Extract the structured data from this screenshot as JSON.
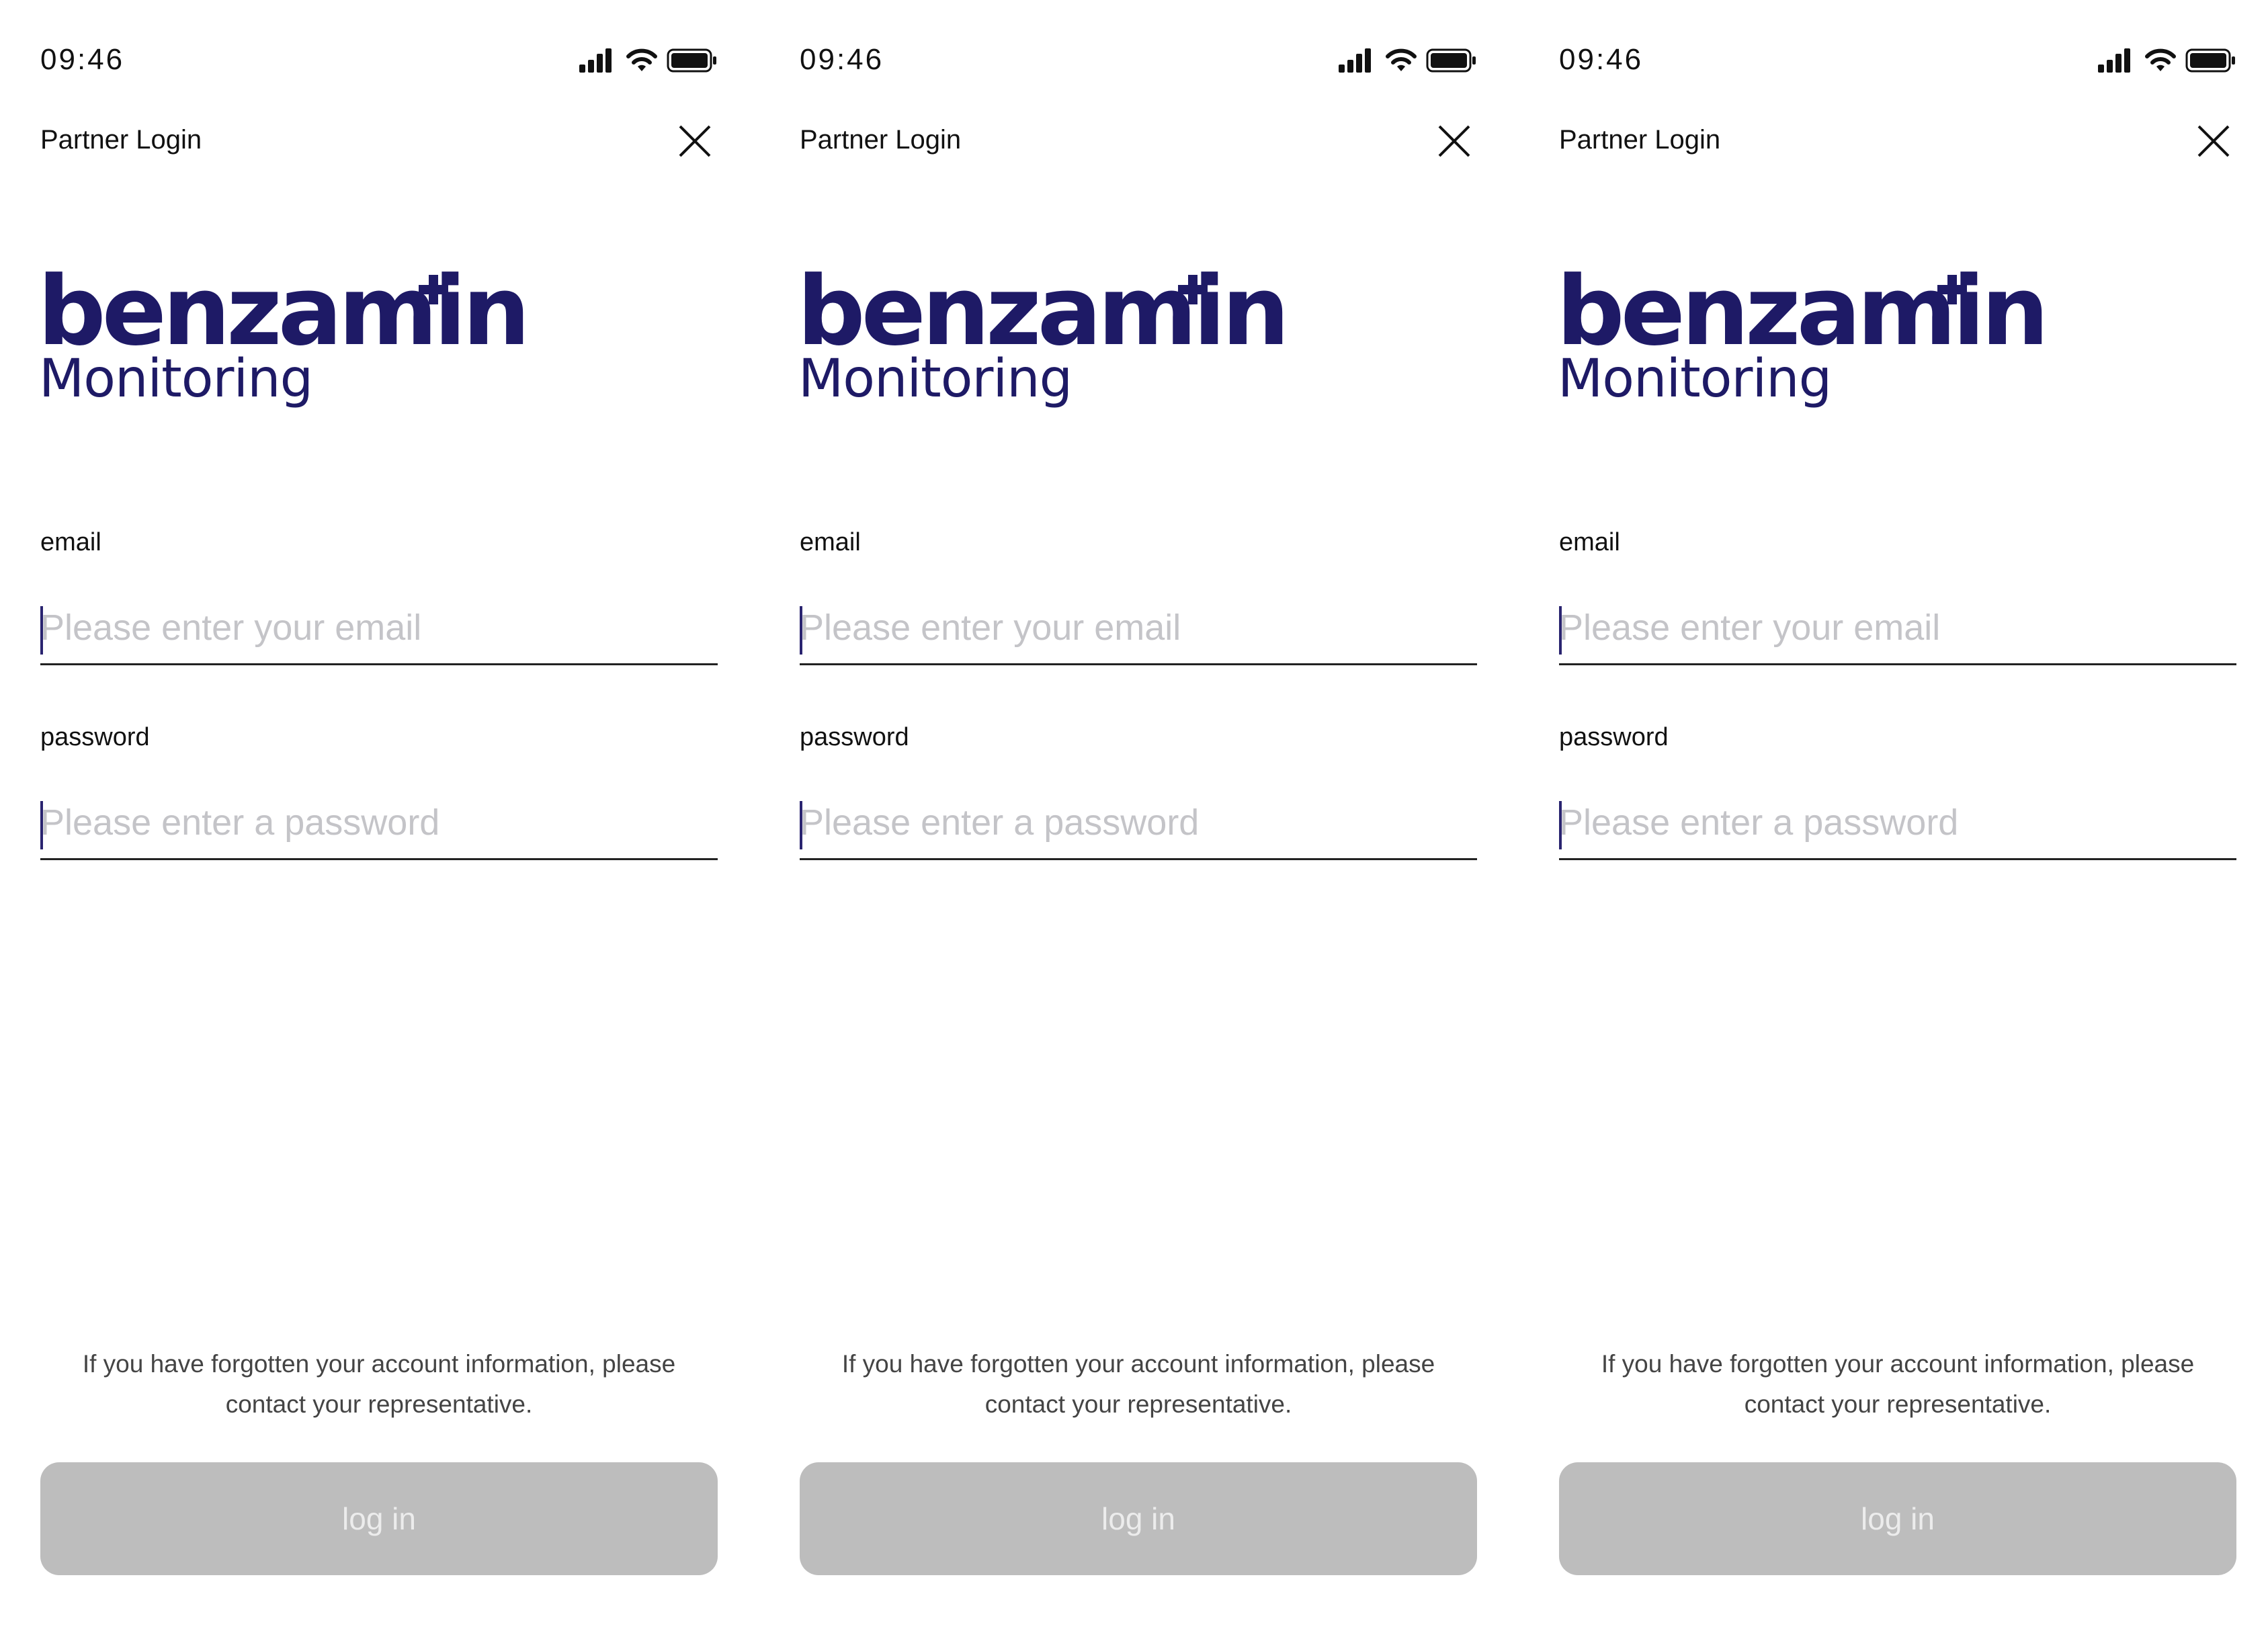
{
  "colors": {
    "brand": "#1e1a66",
    "button_disabled": "#bdbdbd",
    "button_text": "#ececec",
    "placeholder": "#c4c4c8"
  },
  "screens": [
    {
      "status": {
        "time": "09:46",
        "icons": [
          "signal-icon",
          "wifi-icon",
          "battery-icon"
        ]
      },
      "header": {
        "title": "Partner Login",
        "close_icon": "close-icon"
      },
      "logo": {
        "wordmark": "benzamin",
        "plus": "+",
        "subtitle": "Monitoring"
      },
      "form": {
        "email_label": "email",
        "email_placeholder": "Please enter your email",
        "email_value": "",
        "password_label": "password",
        "password_placeholder": "Please enter a password",
        "password_value": ""
      },
      "help_text": "If you have forgotten your account information, please contact your representative.",
      "login_label": "log in"
    },
    {
      "status": {
        "time": "09:46",
        "icons": [
          "signal-icon",
          "wifi-icon",
          "battery-icon"
        ]
      },
      "header": {
        "title": "Partner Login",
        "close_icon": "close-icon"
      },
      "logo": {
        "wordmark": "benzamin",
        "plus": "+",
        "subtitle": "Monitoring"
      },
      "form": {
        "email_label": "email",
        "email_placeholder": "Please enter your email",
        "email_value": "",
        "password_label": "password",
        "password_placeholder": "Please enter a password",
        "password_value": ""
      },
      "help_text": "If you have forgotten your account information, please contact your representative.",
      "login_label": "log in"
    },
    {
      "status": {
        "time": "09:46",
        "icons": [
          "signal-icon",
          "wifi-icon",
          "battery-icon"
        ]
      },
      "header": {
        "title": "Partner Login",
        "close_icon": "close-icon"
      },
      "logo": {
        "wordmark": "benzamin",
        "plus": "+",
        "subtitle": "Monitoring"
      },
      "form": {
        "email_label": "email",
        "email_placeholder": "Please enter your email",
        "email_value": "",
        "password_label": "password",
        "password_placeholder": "Please enter a password",
        "password_value": ""
      },
      "help_text": "If you have forgotten your account information, please contact your representative.",
      "login_label": "log in"
    }
  ]
}
